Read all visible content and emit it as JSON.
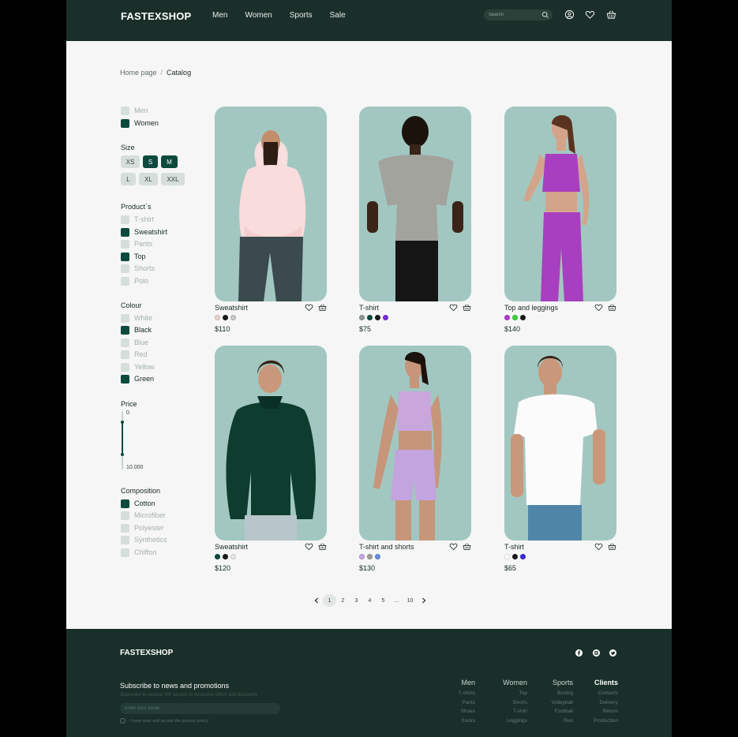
{
  "header": {
    "logo": "FASTEXSHOP",
    "nav": [
      "Men",
      "Women",
      "Sports",
      "Sale"
    ],
    "search_placeholder": "Search"
  },
  "breadcrumb": {
    "home": "Home page",
    "separator": "/",
    "current": "Catalog"
  },
  "filters": {
    "gender": [
      {
        "label": "Men",
        "checked": false
      },
      {
        "label": "Women",
        "checked": true
      }
    ],
    "size_title": "Size",
    "sizes": [
      {
        "label": "XS",
        "selected": false
      },
      {
        "label": "S",
        "selected": true
      },
      {
        "label": "M",
        "selected": true
      },
      {
        "label": "L",
        "selected": false
      },
      {
        "label": "XL",
        "selected": false
      },
      {
        "label": "XXL",
        "selected": false
      }
    ],
    "products_title": "Product`s",
    "products": [
      {
        "label": "T-shirt",
        "checked": false
      },
      {
        "label": "Sweatshirt",
        "checked": true
      },
      {
        "label": "Pants",
        "checked": false
      },
      {
        "label": "Top",
        "checked": true
      },
      {
        "label": "Shorts",
        "checked": false
      },
      {
        "label": "Polo",
        "checked": false
      }
    ],
    "colour_title": "Colour",
    "colours": [
      {
        "label": "White",
        "checked": false
      },
      {
        "label": "Black",
        "checked": true
      },
      {
        "label": "Blue",
        "checked": false
      },
      {
        "label": "Red",
        "checked": false
      },
      {
        "label": "Yellow",
        "checked": false
      },
      {
        "label": "Green",
        "checked": true
      }
    ],
    "price_title": "Price",
    "price_min": "0",
    "price_max": "10.000",
    "composition_title": "Composition",
    "composition": [
      {
        "label": "Cotton",
        "checked": true
      },
      {
        "label": "Microfiber",
        "checked": false
      },
      {
        "label": "Polyester",
        "checked": false
      },
      {
        "label": "Synthetics",
        "checked": false
      },
      {
        "label": "Chiffon",
        "checked": false
      }
    ]
  },
  "products": [
    {
      "name": "Sweatshirt",
      "price": "$110",
      "swatches": [
        "#e9d3d0",
        "#1b1b1b",
        "#c9c9c9"
      ],
      "photo": "woman-pink-hoodie"
    },
    {
      "name": "T-shirt",
      "price": "$75",
      "swatches": [
        "#8e9a98",
        "#0d4a3e",
        "#1b1b1b",
        "#7a2fe0"
      ],
      "photo": "man-grey-tshirt-back"
    },
    {
      "name": "Top and leggings",
      "price": "$140",
      "swatches": [
        "#b23bd1",
        "#3bd13b",
        "#1b1b1b"
      ],
      "photo": "woman-purple-set"
    },
    {
      "name": "Sweatshirt",
      "price": "$120",
      "swatches": [
        "#0d4a3e",
        "#1b1b1b",
        "#e8e8e8"
      ],
      "photo": "man-green-hoodie"
    },
    {
      "name": "T-shirt and shorts",
      "price": "$130",
      "swatches": [
        "#c7a6e0",
        "#a0a0a0",
        "#6a8ee0"
      ],
      "photo": "woman-lilac-set"
    },
    {
      "name": "T-shirt",
      "price": "$65",
      "swatches": [
        "#ffffff",
        "#1b1b1b",
        "#3b2bd8"
      ],
      "photo": "man-white-tshirt"
    }
  ],
  "pagination": {
    "pages": [
      "1",
      "2",
      "3",
      "4",
      "5",
      "...",
      "10"
    ],
    "current": "1"
  },
  "footer": {
    "logo": "FASTEXSHOP",
    "subscribe_title": "Subscribe to news and promotions",
    "subscribe_text": "Subscribe to receive VIP access to exclusive offers and discounts",
    "email_placeholder": "Enter your email",
    "agree_text": "I have read and accept the privacy policy",
    "columns": [
      {
        "title": "Men",
        "links": [
          "T-shirts",
          "Pants",
          "Shoes",
          "Socks"
        ]
      },
      {
        "title": "Women",
        "links": [
          "Top",
          "Shorts",
          "T-shirt",
          "Leggings"
        ]
      },
      {
        "title": "Sports",
        "links": [
          "Boxing",
          "Volleyball",
          "Football",
          "Run"
        ]
      },
      {
        "title": "Clients",
        "links": [
          "Contacts",
          "Delivery",
          "Return",
          "Production"
        ]
      }
    ]
  },
  "colors": {
    "dark_green": "#1a2f29",
    "accent": "#0d4a3e",
    "card_bg": "#a2c7c1",
    "page_bg": "#f6f6f6"
  }
}
